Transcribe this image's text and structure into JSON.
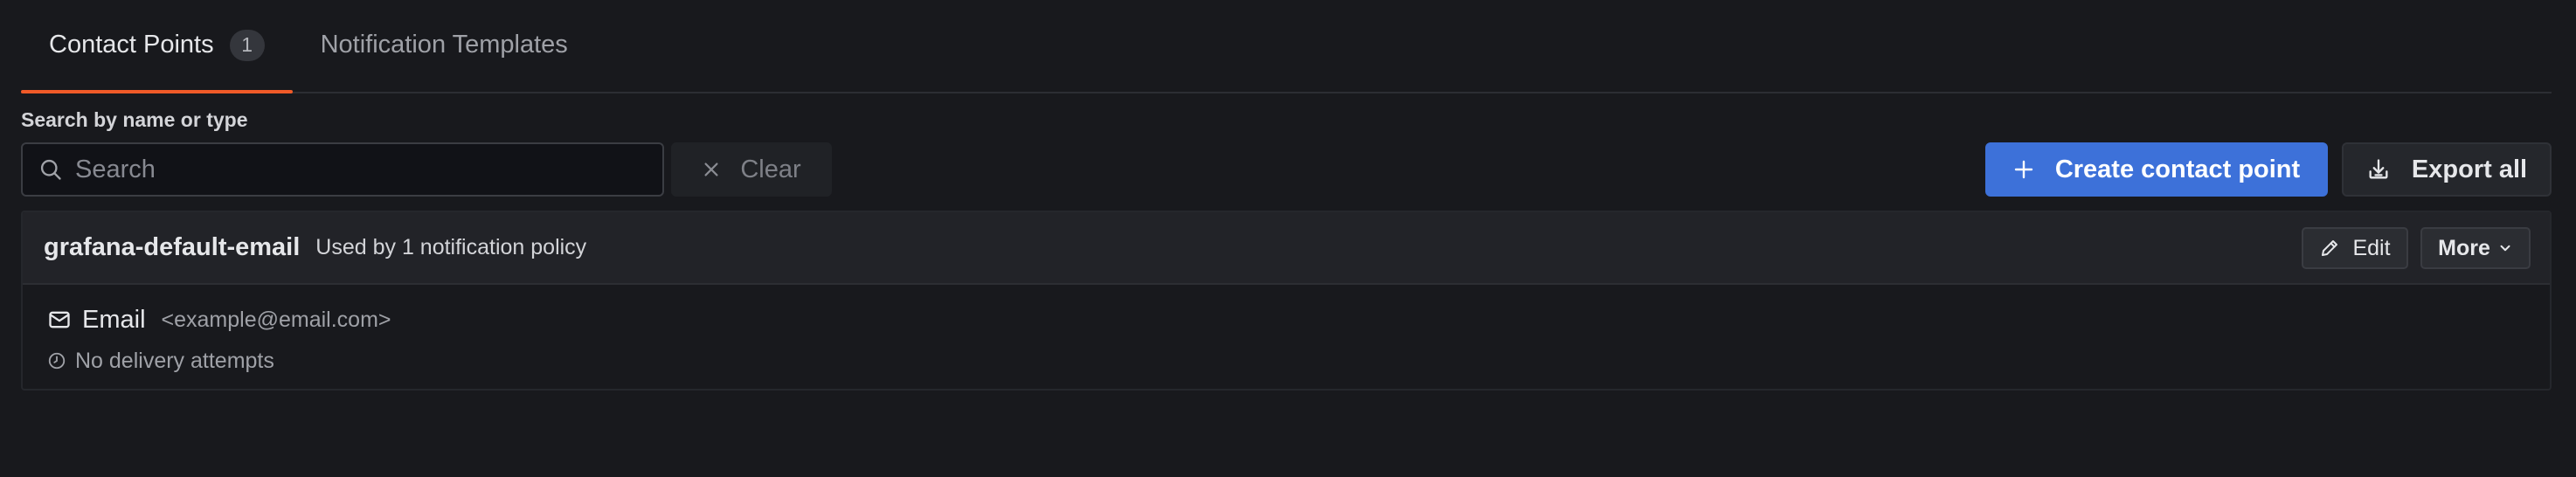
{
  "tabs": [
    {
      "label": "Contact Points",
      "count": "1",
      "active": true
    },
    {
      "label": "Notification Templates",
      "active": false
    }
  ],
  "search": {
    "label": "Search by name or type",
    "placeholder": "Search",
    "value": "",
    "icon": "search-icon"
  },
  "toolbar": {
    "clear_label": "Clear",
    "clear_icon": "close-icon",
    "create_label": "Create contact point",
    "create_icon": "plus-icon",
    "export_label": "Export all",
    "export_icon": "download-icon"
  },
  "contact_point": {
    "name": "grafana-default-email",
    "usage": "Used by 1 notification policy",
    "edit_label": "Edit",
    "edit_icon": "pencil-icon",
    "more_label": "More",
    "more_icon": "chevron-down-icon",
    "integration": {
      "type": "Email",
      "icon": "envelope-icon",
      "address": "<example@email.com>"
    },
    "delivery_status": "No delivery attempts",
    "delivery_icon": "clock-icon"
  },
  "colors": {
    "background": "#18191d",
    "accent": "#f05a28",
    "primary_button": "#3d71d9"
  }
}
